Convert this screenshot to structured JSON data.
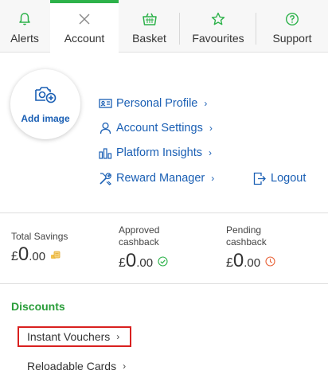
{
  "nav": {
    "tabs": [
      {
        "label": "Alerts",
        "icon": "bell-icon"
      },
      {
        "label": "Account",
        "icon": "close-icon"
      },
      {
        "label": "Basket",
        "icon": "basket-icon"
      },
      {
        "label": "Favourites",
        "icon": "star-icon"
      },
      {
        "label": "Support",
        "icon": "help-icon"
      }
    ],
    "active_tab": "Account",
    "accent": "#2db24a"
  },
  "profile": {
    "add_image_label": "Add image",
    "links": [
      {
        "label": "Personal Profile",
        "icon": "id-card-icon"
      },
      {
        "label": "Account Settings",
        "icon": "user-icon"
      },
      {
        "label": "Platform Insights",
        "icon": "bar-chart-icon"
      },
      {
        "label": "Reward Manager",
        "icon": "tools-icon"
      }
    ],
    "logout_label": "Logout",
    "link_color": "#1a5fb4"
  },
  "savings": {
    "total": {
      "label": "Total Savings",
      "currency": "£",
      "whole": "0",
      "decimal": ".00",
      "icon": "coins-icon"
    },
    "approved": {
      "label_line1": "Approved",
      "label_line2": "cashback",
      "currency": "£",
      "whole": "0",
      "decimal": ".00",
      "icon": "check-circle-icon"
    },
    "pending": {
      "label_line1": "Pending",
      "label_line2": "cashback",
      "currency": "£",
      "whole": "0",
      "decimal": ".00",
      "icon": "clock-icon"
    }
  },
  "discounts": {
    "title": "Discounts",
    "items": [
      {
        "label": "Instant Vouchers",
        "highlighted": true
      },
      {
        "label": "Reloadable Cards",
        "highlighted": false
      }
    ],
    "title_color": "#2a9d3a",
    "highlight_color": "#d9201f"
  }
}
